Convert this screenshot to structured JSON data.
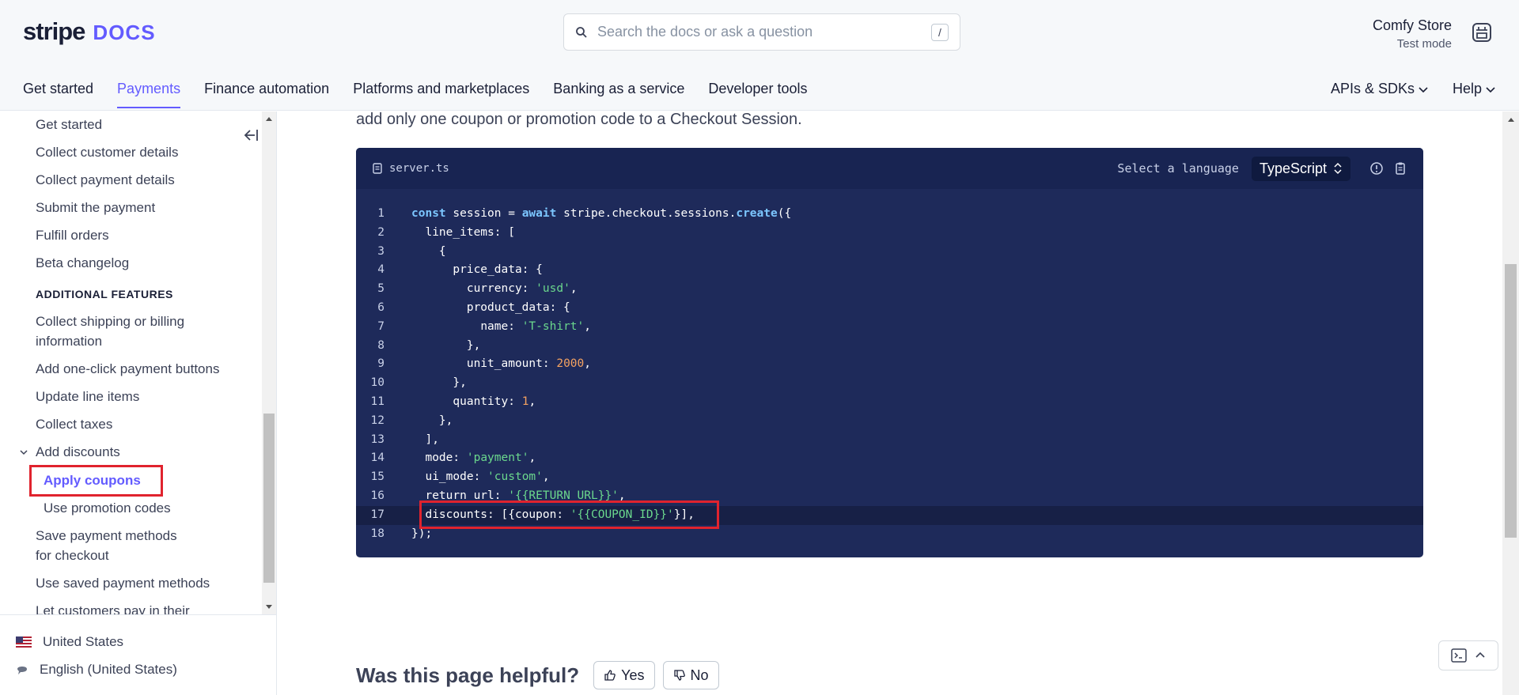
{
  "header": {
    "logo_stripe": "stripe",
    "logo_docs": "DOCS",
    "search_placeholder": "Search the docs or ask a question",
    "search_shortcut": "/",
    "account_name": "Comfy Store",
    "account_mode": "Test mode"
  },
  "nav": {
    "items": [
      "Get started",
      "Payments",
      "Finance automation",
      "Platforms and marketplaces",
      "Banking as a service",
      "Developer tools"
    ],
    "active": "Payments",
    "right": [
      "APIs & SDKs",
      "Help"
    ]
  },
  "sidebar": {
    "items": [
      "Get started",
      "Collect customer details",
      "Collect payment details",
      "Submit the payment",
      "Fulfill orders",
      "Beta changelog"
    ],
    "section": "ADDITIONAL FEATURES",
    "features": [
      "Collect shipping or billing information",
      "Add one-click payment buttons",
      "Update line items",
      "Collect taxes",
      "Add discounts"
    ],
    "sub": [
      "Apply coupons",
      "Use promotion codes"
    ],
    "more": [
      "Save payment methods for checkout",
      "Use saved payment methods",
      "Let customers pay in their"
    ]
  },
  "footer": {
    "country": "United States",
    "language": "English (United States)"
  },
  "main": {
    "intro_text": "add only one coupon or promotion code to a Checkout Session.",
    "file_name": "server.ts",
    "lang_label": "Select a language",
    "lang_value": "TypeScript",
    "line_numbers": [
      "1",
      "2",
      "3",
      "4",
      "5",
      "6",
      "7",
      "8",
      "9",
      "10",
      "11",
      "12",
      "13",
      "14",
      "15",
      "16",
      "17",
      "18"
    ],
    "helpful_question": "Was this page helpful?",
    "yes_label": "Yes",
    "no_label": "No"
  },
  "code": {
    "l1": [
      "const",
      "session",
      "=",
      "await",
      "stripe.checkout.sessions.",
      "create",
      "({"
    ],
    "l2": "line_items: [",
    "l3": "{",
    "l4": "price_data: {",
    "l5": [
      "currency: ",
      "'usd'",
      ","
    ],
    "l6": "product_data: {",
    "l7": [
      "name: ",
      "'T-shirt'",
      ","
    ],
    "l8": "},",
    "l9": [
      "unit_amount: ",
      "2000",
      ","
    ],
    "l10": "},",
    "l11": [
      "quantity: ",
      "1",
      ","
    ],
    "l12": "},",
    "l13": "],",
    "l14": [
      "mode: ",
      "'payment'",
      ","
    ],
    "l15": [
      "ui_mode: ",
      "'custom'",
      ","
    ],
    "l16": [
      "return_url: ",
      "'{{RETURN_URL}}'",
      ","
    ],
    "l17": [
      "discounts: [{coupon: ",
      "'{{COUPON_ID}}'",
      "}],"
    ],
    "l18": "});"
  },
  "colors": {
    "accent": "#635bff",
    "code_bg": "#1e2a5a",
    "highlight_border": "#e0232e"
  }
}
